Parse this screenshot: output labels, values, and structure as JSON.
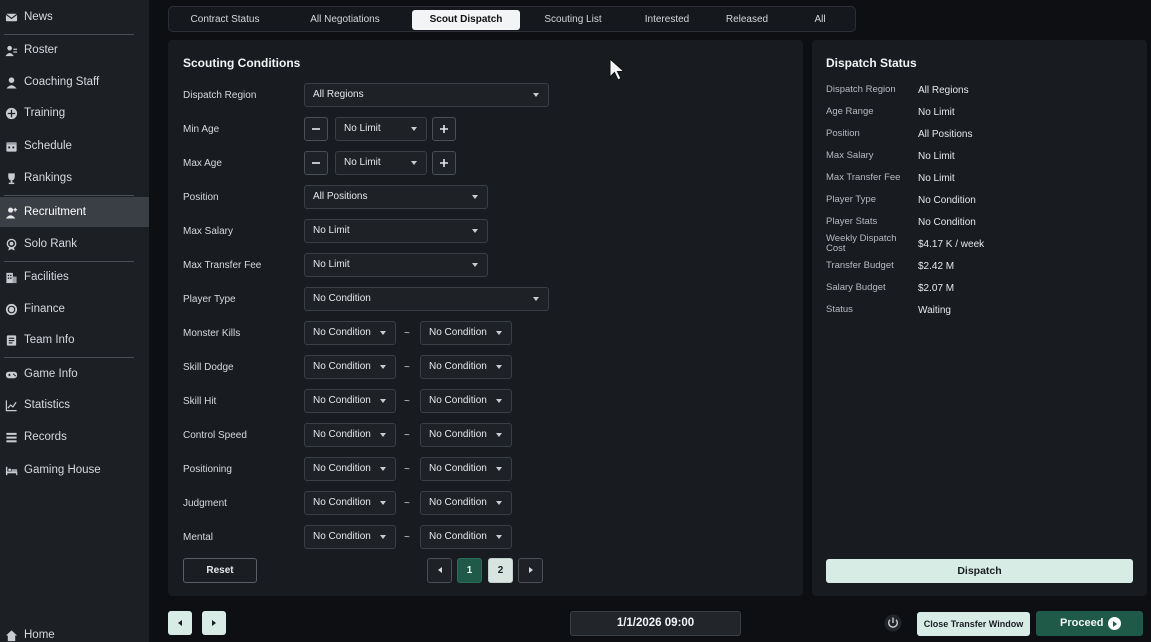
{
  "sidebar": {
    "items": [
      {
        "label": "News",
        "icon": "mail-icon"
      },
      {
        "label": "Roster",
        "icon": "people-icon"
      },
      {
        "label": "Coaching Staff",
        "icon": "person-icon"
      },
      {
        "label": "Training",
        "icon": "training-icon"
      },
      {
        "label": "Schedule",
        "icon": "calendar-icon"
      },
      {
        "label": "Rankings",
        "icon": "trophy-icon"
      },
      {
        "label": "Recruitment",
        "icon": "add-person-icon"
      },
      {
        "label": "Solo Rank",
        "icon": "medal-icon"
      },
      {
        "label": "Facilities",
        "icon": "building-icon"
      },
      {
        "label": "Finance",
        "icon": "coin-icon"
      },
      {
        "label": "Team Info",
        "icon": "document-icon"
      },
      {
        "label": "Game Info",
        "icon": "gamepad-icon"
      },
      {
        "label": "Statistics",
        "icon": "chart-icon"
      },
      {
        "label": "Records",
        "icon": "list-icon"
      },
      {
        "label": "Gaming House",
        "icon": "bed-icon"
      },
      {
        "label": "Home",
        "icon": "home-icon"
      }
    ],
    "active": "Recruitment"
  },
  "tabs": [
    "Contract Status",
    "All Negotiations",
    "Scout Dispatch",
    "Scouting List",
    "Interested",
    "Released",
    "All"
  ],
  "active_tab": "Scout Dispatch",
  "conditions": {
    "title": "Scouting Conditions",
    "dispatch_region": {
      "label": "Dispatch Region",
      "value": "All Regions"
    },
    "min_age": {
      "label": "Min Age",
      "value": "No Limit"
    },
    "max_age": {
      "label": "Max Age",
      "value": "No Limit"
    },
    "position": {
      "label": "Position",
      "value": "All Positions"
    },
    "max_salary": {
      "label": "Max Salary",
      "value": "No Limit"
    },
    "max_transfer_fee": {
      "label": "Max Transfer Fee",
      "value": "No Limit"
    },
    "player_type": {
      "label": "Player Type",
      "value": "No Condition"
    },
    "tilde": "~",
    "stats": [
      {
        "label": "Monster Kills",
        "from": "No Condition",
        "to": "No Condition"
      },
      {
        "label": "Skill Dodge",
        "from": "No Condition",
        "to": "No Condition"
      },
      {
        "label": "Skill Hit",
        "from": "No Condition",
        "to": "No Condition"
      },
      {
        "label": "Control Speed",
        "from": "No Condition",
        "to": "No Condition"
      },
      {
        "label": "Positioning",
        "from": "No Condition",
        "to": "No Condition"
      },
      {
        "label": "Judgment",
        "from": "No Condition",
        "to": "No Condition"
      },
      {
        "label": "Mental",
        "from": "No Condition",
        "to": "No Condition"
      }
    ],
    "reset_label": "Reset",
    "pages": [
      "1",
      "2"
    ],
    "current_page": "1"
  },
  "status": {
    "title": "Dispatch Status",
    "rows": [
      {
        "label": "Dispatch Region",
        "value": "All Regions"
      },
      {
        "label": "Age Range",
        "value": "No Limit"
      },
      {
        "label": "Position",
        "value": "All Positions"
      },
      {
        "label": "Max Salary",
        "value": "No Limit"
      },
      {
        "label": "Max Transfer Fee",
        "value": "No Limit"
      },
      {
        "label": "Player Type",
        "value": "No Condition"
      },
      {
        "label": "Player Stats",
        "value": "No Condition"
      },
      {
        "label": "Weekly Dispatch Cost",
        "value": "$4.17 K / week"
      },
      {
        "label": "Transfer Budget",
        "value": "$2.42 M"
      },
      {
        "label": "Salary Budget",
        "value": "$2.07 M"
      },
      {
        "label": "Status",
        "value": "Waiting"
      }
    ],
    "dispatch_label": "Dispatch"
  },
  "bottom": {
    "datetime": "1/1/2026 09:00",
    "close_window_label": "Close Transfer Window",
    "proceed_label": "Proceed"
  },
  "colors": {
    "accent_green": "#1f5a49",
    "light_button": "#d8ece6",
    "background": "#0d0f12",
    "panel": "#181b1f"
  }
}
